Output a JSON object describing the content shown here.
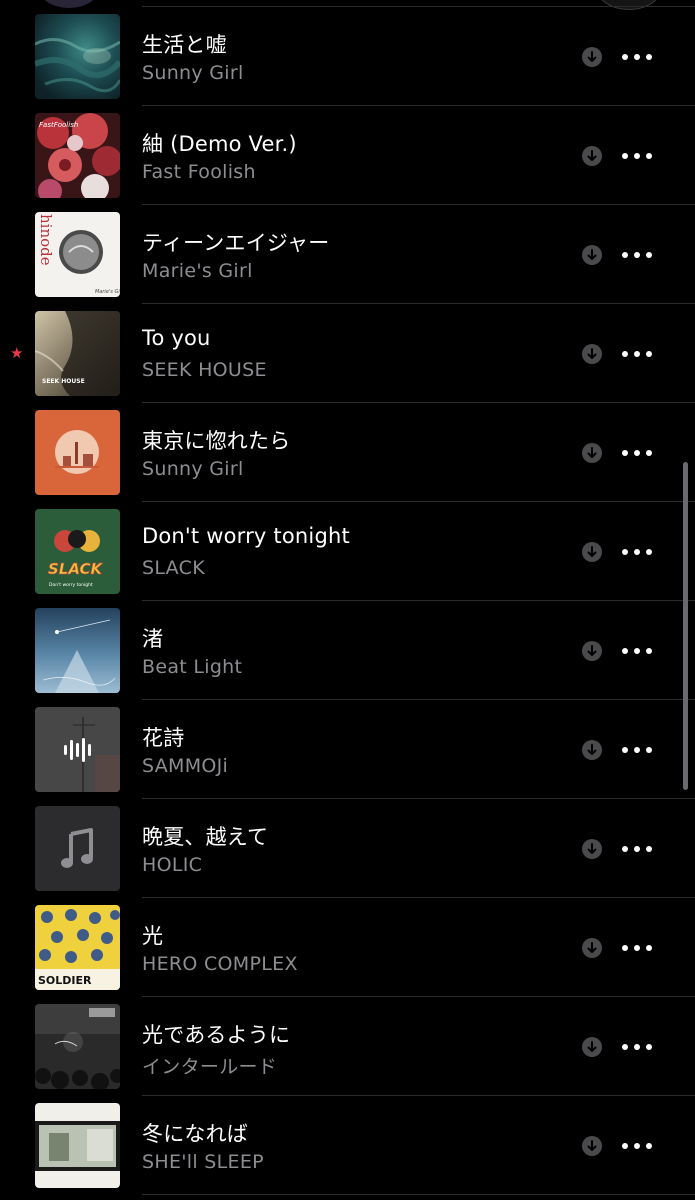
{
  "tracks": [
    {
      "title": "生活と嘘",
      "artist": "Sunny Girl",
      "favorite": false,
      "art": "teal-water"
    },
    {
      "title": "紬 (Demo Ver.)",
      "artist": "Fast Foolish",
      "favorite": false,
      "art": "red-flowers"
    },
    {
      "title": "ティーンエイジャー",
      "artist": "Marie's Girl",
      "favorite": false,
      "art": "white-circle"
    },
    {
      "title": "To you",
      "artist": "SEEK HOUSE",
      "favorite": true,
      "art": "sepia-shore"
    },
    {
      "title": "東京に惚れたら",
      "artist": "Sunny Girl",
      "favorite": false,
      "art": "orange-tower"
    },
    {
      "title": "Don't worry tonight",
      "artist": "SLACK",
      "favorite": false,
      "art": "green-slack"
    },
    {
      "title": "渚",
      "artist": "Beat Light",
      "favorite": false,
      "art": "blue-night"
    },
    {
      "title": "花詩",
      "artist": "SAMMOJi",
      "favorite": false,
      "art": "now-playing"
    },
    {
      "title": "晩夏、越えて",
      "artist": "HOLIC",
      "favorite": false,
      "art": "music-note"
    },
    {
      "title": "光",
      "artist": "HERO COMPLEX",
      "favorite": false,
      "art": "yellow-soldier"
    },
    {
      "title": "光であるように",
      "artist": "インタールード",
      "favorite": false,
      "art": "dark-concert"
    },
    {
      "title": "冬になれば",
      "artist": "SHE'll SLEEP",
      "favorite": false,
      "art": "photo-frame"
    }
  ],
  "art_text": {
    "fast_foolish": "FastFoolish",
    "hinode": "hinode",
    "maries_girl": "Marie's Girl",
    "seek_house": "SEEK HOUSE",
    "slack": "SLACK",
    "dont_worry": "Don't worry tonight",
    "soldier": "SOLDIER"
  },
  "colors": {
    "background": "#000000",
    "title": "#ffffff",
    "artist": "#8d8d92",
    "favorite_star": "#e8394a",
    "divider": "#2b2b2b"
  },
  "icons": {
    "download": "download-circle-icon",
    "more": "more-horizontal-icon",
    "favorite": "star-icon",
    "placeholder": "music-note-icon",
    "playing": "waveform-icon"
  }
}
